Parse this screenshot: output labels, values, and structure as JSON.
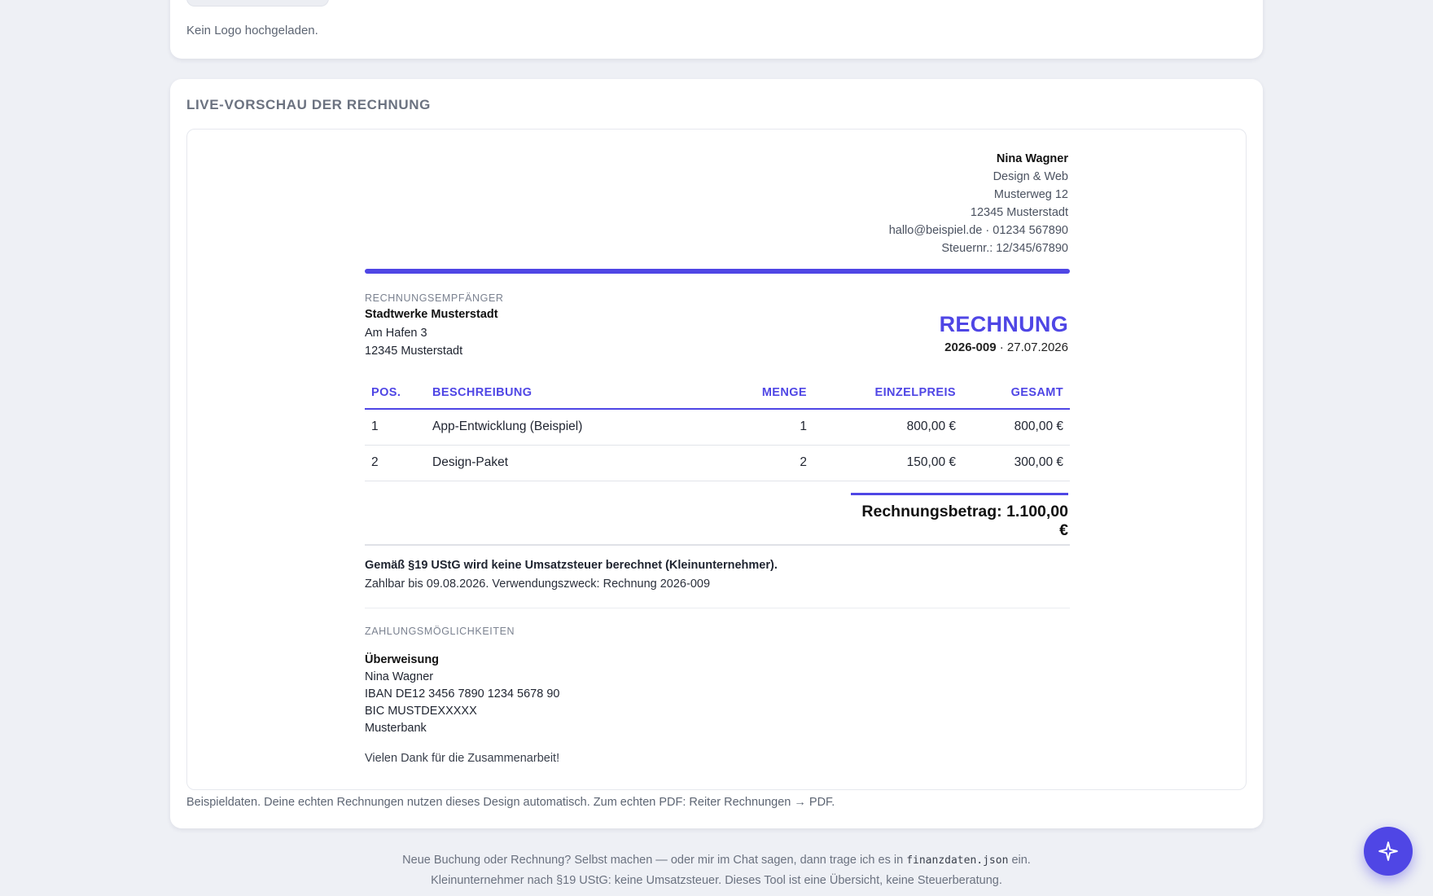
{
  "logo_section": {
    "status_text": "Kein Logo hochgeladen."
  },
  "preview": {
    "heading": "LIVE-VORSCHAU DER RECHNUNG",
    "footnote": "Beispieldaten. Deine echten Rechnungen nutzen dieses Design automatisch. Zum echten PDF: Reiter Rechnungen → PDF."
  },
  "invoice": {
    "sender": {
      "name": "Nina Wagner",
      "tagline": "Design & Web",
      "street": "Musterweg 12",
      "city": "12345 Musterstadt",
      "contact": "hallo@beispiel.de · 01234 567890",
      "tax_id": "Steuernr.: 12/345/67890"
    },
    "recipient": {
      "caption": "RECHNUNGSEMPFÄNGER",
      "name": "Stadtwerke Musterstadt",
      "street": "Am Hafen 3",
      "city": "12345 Musterstadt"
    },
    "title": "RECHNUNG",
    "number": "2026-009",
    "meta_separator": " · ",
    "date": "27.07.2026",
    "table": {
      "headers": {
        "pos": "POS.",
        "description": "BESCHREIBUNG",
        "quantity": "MENGE",
        "unit_price": "EINZELPREIS",
        "total": "GESAMT"
      },
      "rows": [
        {
          "pos": "1",
          "description": "App-Entwicklung (Beispiel)",
          "quantity": "1",
          "unit_price": "800,00 €",
          "total": "800,00 €"
        },
        {
          "pos": "2",
          "description": "Design-Paket",
          "quantity": "2",
          "unit_price": "150,00 €",
          "total": "300,00 €"
        }
      ]
    },
    "total_label": "Rechnungsbetrag: 1.100,00 €",
    "tax_note": "Gemäß §19 UStG wird keine Umsatzsteuer berechnet (Kleinunternehmer).",
    "payment_due": "Zahlbar bis 09.08.2026. Verwendungszweck: Rechnung 2026-009",
    "payment": {
      "caption": "ZAHLUNGSMÖGLICHKEITEN",
      "method": "Überweisung",
      "account_holder": "Nina Wagner",
      "iban": "IBAN DE12 3456 7890 1234 5678 90",
      "bic": "BIC MUSTDEXXXXX",
      "bank": "Musterbank"
    },
    "thanks": "Vielen Dank für die Zusammenarbeit!"
  },
  "footer": {
    "line1_before": "Neue Buchung oder Rechnung? Selbst machen — oder mir im Chat sagen, dann trage ich es in ",
    "line1_code": "finanzdaten.json",
    "line1_after": " ein.",
    "line2": "Kleinunternehmer nach §19 UStG: keine Umsatzsteuer. Dieses Tool ist eine Übersicht, keine Steuerberatung."
  },
  "fab": {
    "icon": "sparkle-icon"
  },
  "colors": {
    "accent": "#4f46e5",
    "background": "#eef0f5",
    "card": "#ffffff"
  }
}
